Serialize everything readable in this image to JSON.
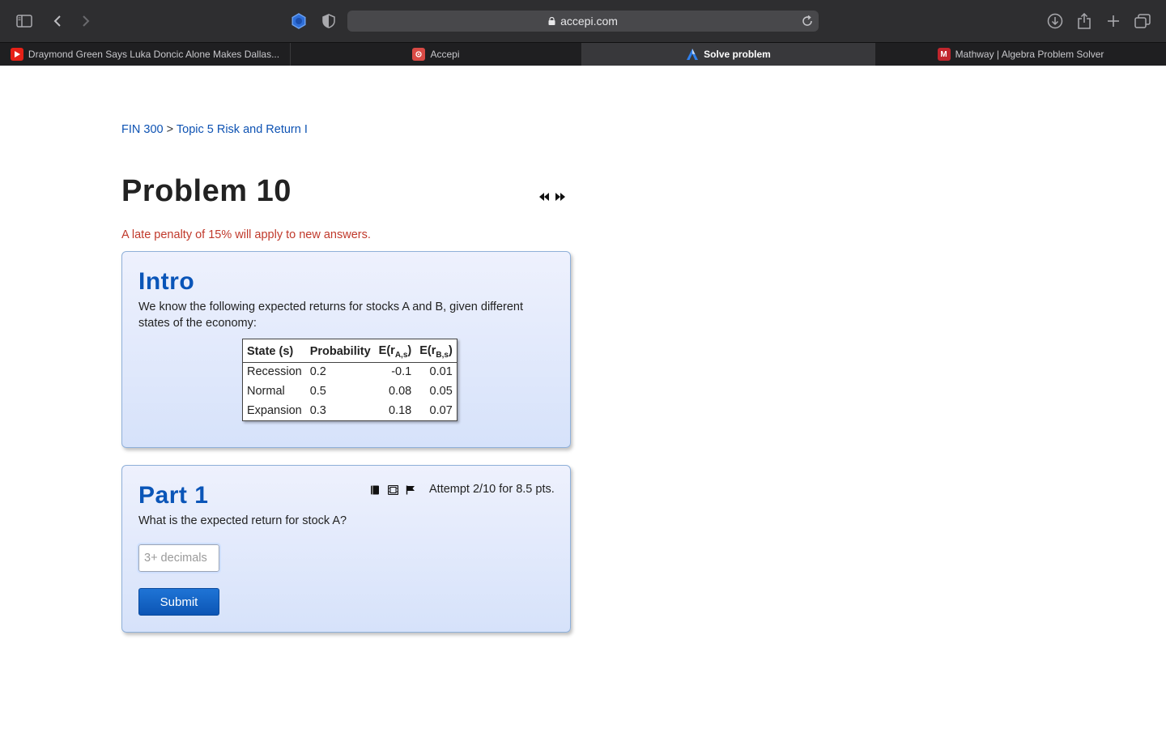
{
  "browser": {
    "url": "accepi.com",
    "tabs": [
      {
        "label": "Draymond Green Says Luka Doncic Alone Makes Dallas...",
        "icon": "youtube-icon",
        "active": false
      },
      {
        "label": "Accepi",
        "icon": "accepi-icon",
        "active": false
      },
      {
        "label": "Solve problem",
        "icon": "accepi-a-icon",
        "active": true
      },
      {
        "label": "Mathway | Algebra Problem Solver",
        "icon": "mathway-icon",
        "active": false
      }
    ]
  },
  "breadcrumb": {
    "course": "FIN 300",
    "separator": ">",
    "topic": "Topic 5 Risk and Return I"
  },
  "problem": {
    "title": "Problem 10",
    "penalty": "A late penalty of 15% will apply to new answers."
  },
  "intro": {
    "heading": "Intro",
    "text": "We know the following expected returns for stocks A and B, given different states of the economy:",
    "table": {
      "headers": [
        "State (s)",
        "Probability",
        "E(r",
        "E(r"
      ],
      "subscripts": [
        "A,s",
        "B,s"
      ],
      "close_paren": ")",
      "rows": [
        [
          "Recession",
          "0.2",
          "-0.1",
          "0.01"
        ],
        [
          "Normal",
          "0.5",
          "0.08",
          "0.05"
        ],
        [
          "Expansion",
          "0.3",
          "0.18",
          "0.07"
        ]
      ]
    }
  },
  "part1": {
    "heading": "Part 1",
    "attempt": "Attempt 2/10 for 8.5 pts.",
    "question": "What is the expected return for stock A?",
    "input_placeholder": "3+ decimals",
    "submit_label": "Submit"
  },
  "colors": {
    "accent": "#0a55b8",
    "penalty": "#c0392b",
    "link": "#0d52b3"
  }
}
